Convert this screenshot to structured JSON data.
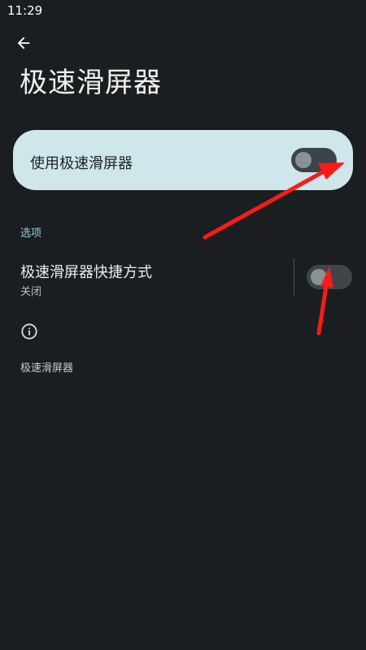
{
  "status_bar": {
    "time": "11:29"
  },
  "header": {
    "title": "极速滑屏器"
  },
  "main_toggle": {
    "label": "使用极速滑屏器",
    "on": false
  },
  "options": {
    "section_label": "选项",
    "shortcut": {
      "title": "极速滑屏器快捷方式",
      "subtitle": "关闭",
      "on": false
    }
  },
  "footer": {
    "text": "极速滑屏器"
  },
  "icons": {
    "back": "arrow-back-icon",
    "info": "info-icon"
  },
  "colors": {
    "background": "#1b1e20",
    "card": "#cfe7eb",
    "accent": "#8fcdd6",
    "switch_track": "#3f4548",
    "switch_thumb": "#8b9295",
    "annotation": "#ff1a1a"
  }
}
